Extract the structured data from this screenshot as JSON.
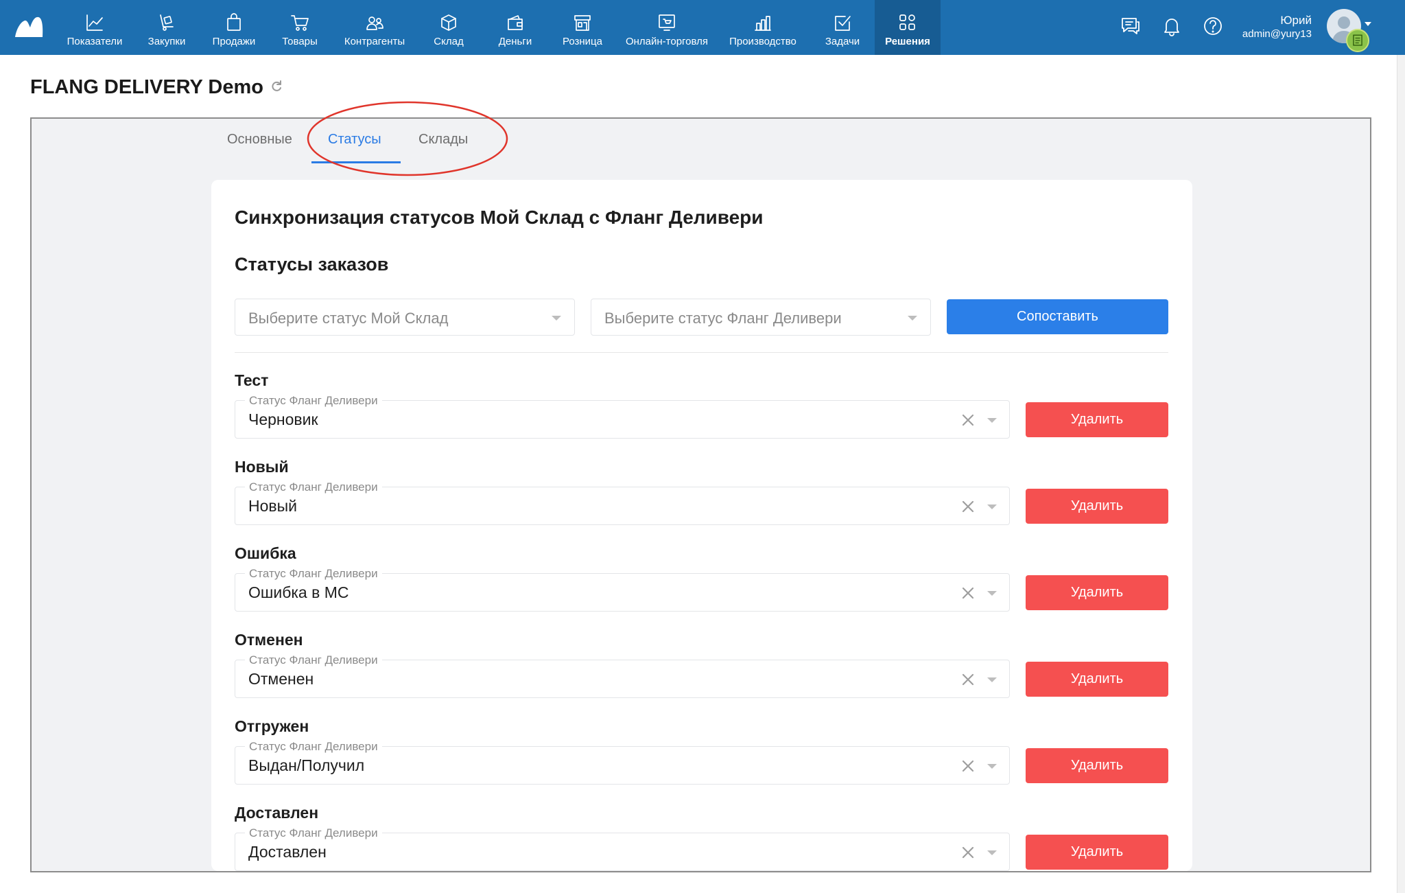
{
  "nav": {
    "items": [
      {
        "label": "Показатели",
        "icon": "chart-line-icon"
      },
      {
        "label": "Закупки",
        "icon": "cart-dolly-icon"
      },
      {
        "label": "Продажи",
        "icon": "shopping-bag-icon"
      },
      {
        "label": "Товары",
        "icon": "cart-icon"
      },
      {
        "label": "Контрагенты",
        "icon": "users-icon"
      },
      {
        "label": "Склад",
        "icon": "box-icon"
      },
      {
        "label": "Деньги",
        "icon": "wallet-icon"
      },
      {
        "label": "Розница",
        "icon": "storefront-icon"
      },
      {
        "label": "Онлайн-торговля",
        "icon": "online-shop-icon"
      },
      {
        "label": "Производство",
        "icon": "factory-icon"
      },
      {
        "label": "Задачи",
        "icon": "task-check-icon"
      },
      {
        "label": "Решения",
        "icon": "apps-grid-icon"
      }
    ],
    "active": "Решения"
  },
  "user": {
    "name": "Юрий",
    "email": "admin@yury13"
  },
  "page": {
    "title": "FLANG DELIVERY Demo"
  },
  "tabs": [
    {
      "label": "Основные"
    },
    {
      "label": "Статусы"
    },
    {
      "label": "Склады"
    }
  ],
  "active_tab": "Статусы",
  "content": {
    "heading": "Синхронизация статусов Мой Склад с Фланг Деливери",
    "subheading": "Статусы заказов",
    "select_ms_placeholder": "Выберите статус Мой Склад",
    "select_fd_placeholder": "Выберите статус Фланг Деливери",
    "match_button": "Сопоставить",
    "field_label": "Статус Фланг Деливери",
    "delete_label": "Удалить",
    "mappings": [
      {
        "ms_status": "Тест",
        "fd_status": "Черновик"
      },
      {
        "ms_status": "Новый",
        "fd_status": "Новый"
      },
      {
        "ms_status": "Ошибка",
        "fd_status": "Ошибка в МС"
      },
      {
        "ms_status": "Отменен",
        "fd_status": "Отменен"
      },
      {
        "ms_status": "Отгружен",
        "fd_status": "Выдан/Получил"
      },
      {
        "ms_status": "Доставлен",
        "fd_status": "Доставлен"
      }
    ]
  },
  "colors": {
    "topbar": "#1d6fb0",
    "accent": "#2b7fe8",
    "danger": "#f55050",
    "annotation": "#e0352b"
  }
}
